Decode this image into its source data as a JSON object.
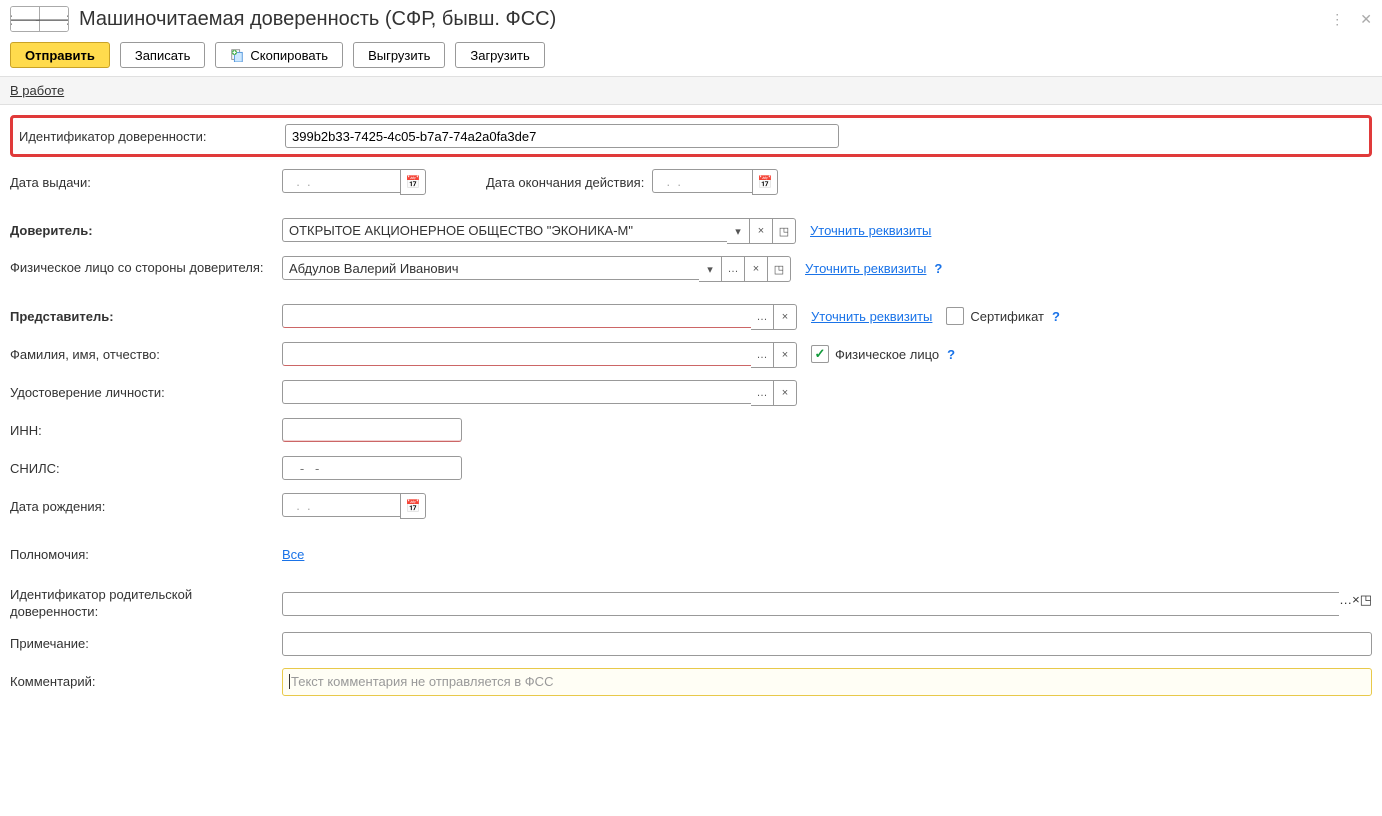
{
  "header": {
    "title": "Машиночитаемая доверенность (СФР, бывш. ФСС)"
  },
  "toolbar": {
    "send": "Отправить",
    "save": "Записать",
    "copy": "Скопировать",
    "export": "Выгрузить",
    "import": "Загрузить"
  },
  "status": {
    "label": "В работе"
  },
  "labels": {
    "id": "Идентификатор доверенности:",
    "issue_date": "Дата выдачи:",
    "end_date": "Дата окончания действия:",
    "principal": "Доверитель:",
    "principal_person": "Физическое лицо со стороны доверителя:",
    "rep": "Представитель:",
    "fio": "Фамилия, имя, отчество:",
    "idcard": "Удостоверение личности:",
    "inn": "ИНН:",
    "snils": "СНИЛС:",
    "birth": "Дата рождения:",
    "powers": "Полномочия:",
    "parent_id": "Идентификатор родительской доверенности:",
    "note": "Примечание:",
    "comment": "Комментарий:",
    "refine": "Уточнить реквизиты",
    "cert": "Сертификат",
    "indiv": "Физическое лицо",
    "all": "Все",
    "comment_ph": "Текст комментария не отправляется в ФСС",
    "date_mask": "  .  .    ",
    "snils_mask": "   -   -"
  },
  "values": {
    "id": "399b2b33-7425-4c05-b7a7-74a2a0fa3de7",
    "principal": "ОТКРЫТОЕ АКЦИОНЕРНОЕ ОБЩЕСТВО \"ЭКОНИКА-М\"",
    "principal_person": "Абдулов Валерий Иванович",
    "rep": "",
    "fio": "",
    "idcard": "",
    "inn": "",
    "note": "",
    "parent_id": ""
  },
  "checks": {
    "cert": false,
    "indiv": true
  }
}
